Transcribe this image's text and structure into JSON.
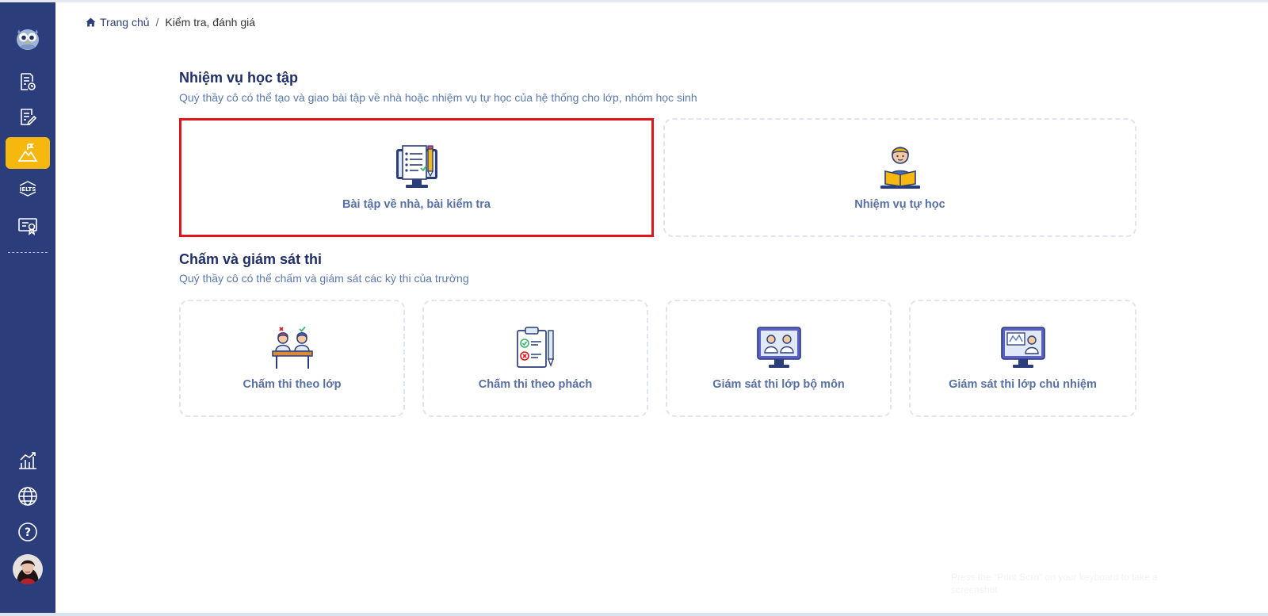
{
  "breadcrumb": {
    "home_label": "Trang chủ",
    "separator": "/",
    "current": "Kiểm tra, đánh giá"
  },
  "sidebar": {
    "items": [
      {
        "icon": "owl-logo-icon"
      },
      {
        "icon": "document-check-icon"
      },
      {
        "icon": "document-edit-icon"
      },
      {
        "icon": "mountain-flag-icon",
        "active": true
      },
      {
        "icon": "ielts-icon",
        "label": "IELTS"
      },
      {
        "icon": "certificate-icon"
      },
      {
        "icon": "chart-icon"
      },
      {
        "icon": "globe-icon"
      },
      {
        "icon": "help-icon",
        "label": "?"
      },
      {
        "icon": "user-avatar"
      }
    ],
    "active_color": "#f6b80e",
    "background": "#2b3d7a"
  },
  "section1": {
    "title": "Nhiệm vụ học tập",
    "description": "Quý thầy cô có thể tạo và giao bài tập về nhà hoặc nhiệm vụ tự học của hệ thống cho lớp, nhóm học sinh",
    "cards": [
      {
        "label": "Bài tập về nhà, bài kiểm tra",
        "icon": "homework-monitor-icon",
        "selected": true
      },
      {
        "label": "Nhiệm vụ tự học",
        "icon": "student-reading-icon"
      }
    ]
  },
  "section2": {
    "title": "Chấm và giám sát thi",
    "description": "Quý thầy cô có thể chấm và giám sát các kỳ thi của trường",
    "cards": [
      {
        "label": "Chấm thi theo lớp",
        "icon": "students-desk-icon"
      },
      {
        "label": "Chấm thi theo phách",
        "icon": "clipboard-checklist-icon"
      },
      {
        "label": "Giám sát thi lớp bộ môn",
        "icon": "monitor-students-icon"
      },
      {
        "label": "Giám sát thi lớp chủ nhiệm",
        "icon": "monitor-classroom-icon"
      }
    ]
  },
  "hint_text": "Press the \"Print Scrn\" on your keyboard to take a screenshot",
  "colors": {
    "title": "#1f2f6b",
    "description": "#5b78b0",
    "card_label": "#5870a8",
    "selected_border": "#e4141b"
  }
}
